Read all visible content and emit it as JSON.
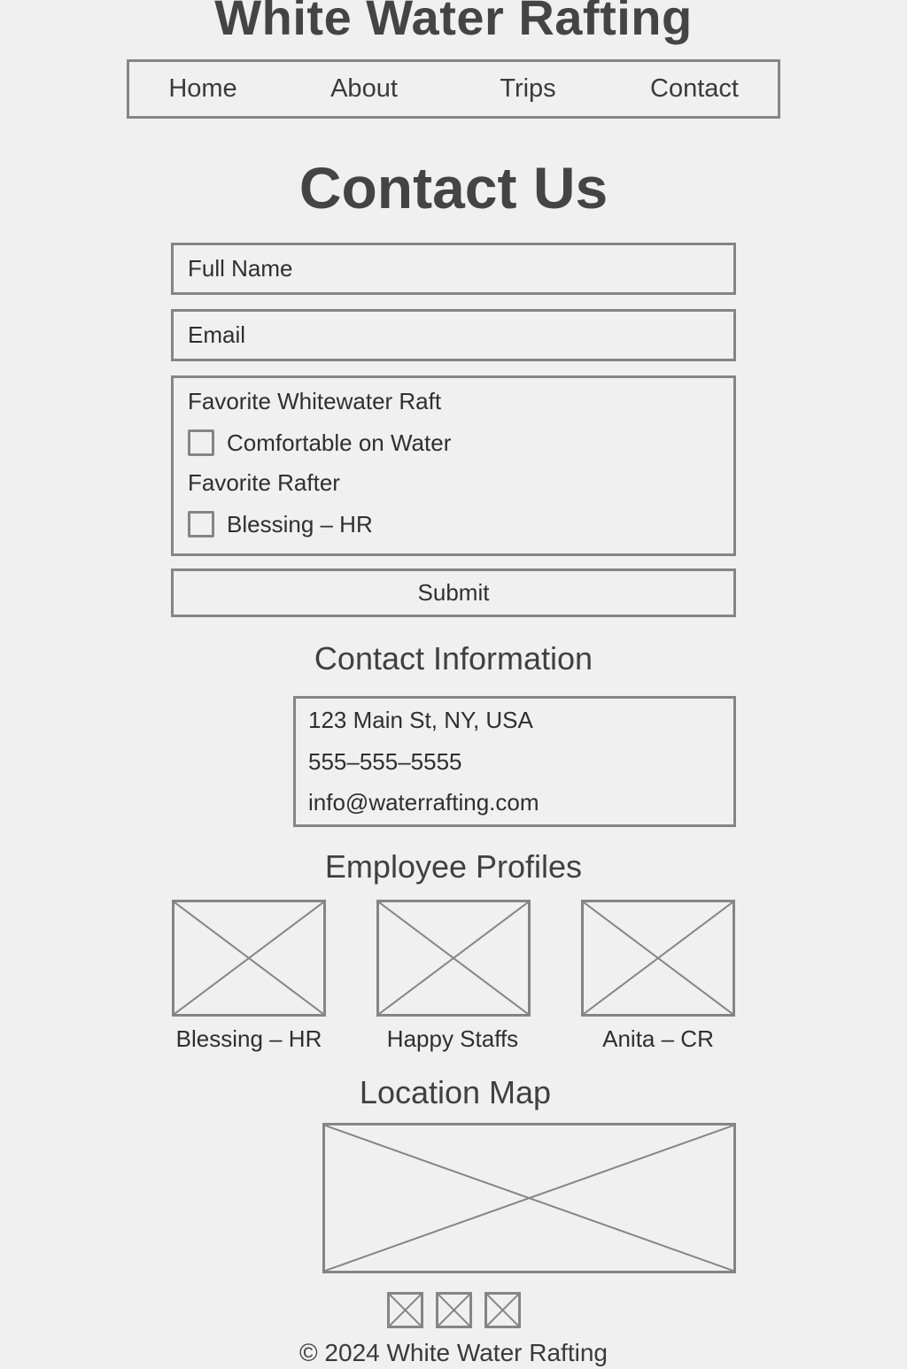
{
  "header": {
    "site_title": "White Water Rafting"
  },
  "nav": {
    "items": [
      {
        "label": "Home"
      },
      {
        "label": "About"
      },
      {
        "label": "Trips"
      },
      {
        "label": "Contact"
      }
    ]
  },
  "main": {
    "page_title": "Contact Us",
    "form": {
      "full_name_placeholder": "Full Name",
      "email_placeholder": "Email",
      "raft_label": "Favorite Whitewater Raft",
      "raft_option": "Comfortable on Water",
      "rafter_label": "Favorite Rafter",
      "rafter_option": "Blessing – HR",
      "submit_label": "Submit"
    },
    "contact_info": {
      "heading": "Contact Information",
      "address": "123 Main St, NY, USA",
      "phone": "555–555–5555",
      "email": "info@waterrafting.com"
    },
    "employees": {
      "heading": "Employee Profiles",
      "profiles": [
        {
          "caption": "Blessing – HR"
        },
        {
          "caption": "Happy Staffs"
        },
        {
          "caption": "Anita – CR"
        }
      ]
    },
    "map": {
      "heading": "Location Map"
    }
  },
  "footer": {
    "copyright": "© 2024 White Water Rafting"
  }
}
